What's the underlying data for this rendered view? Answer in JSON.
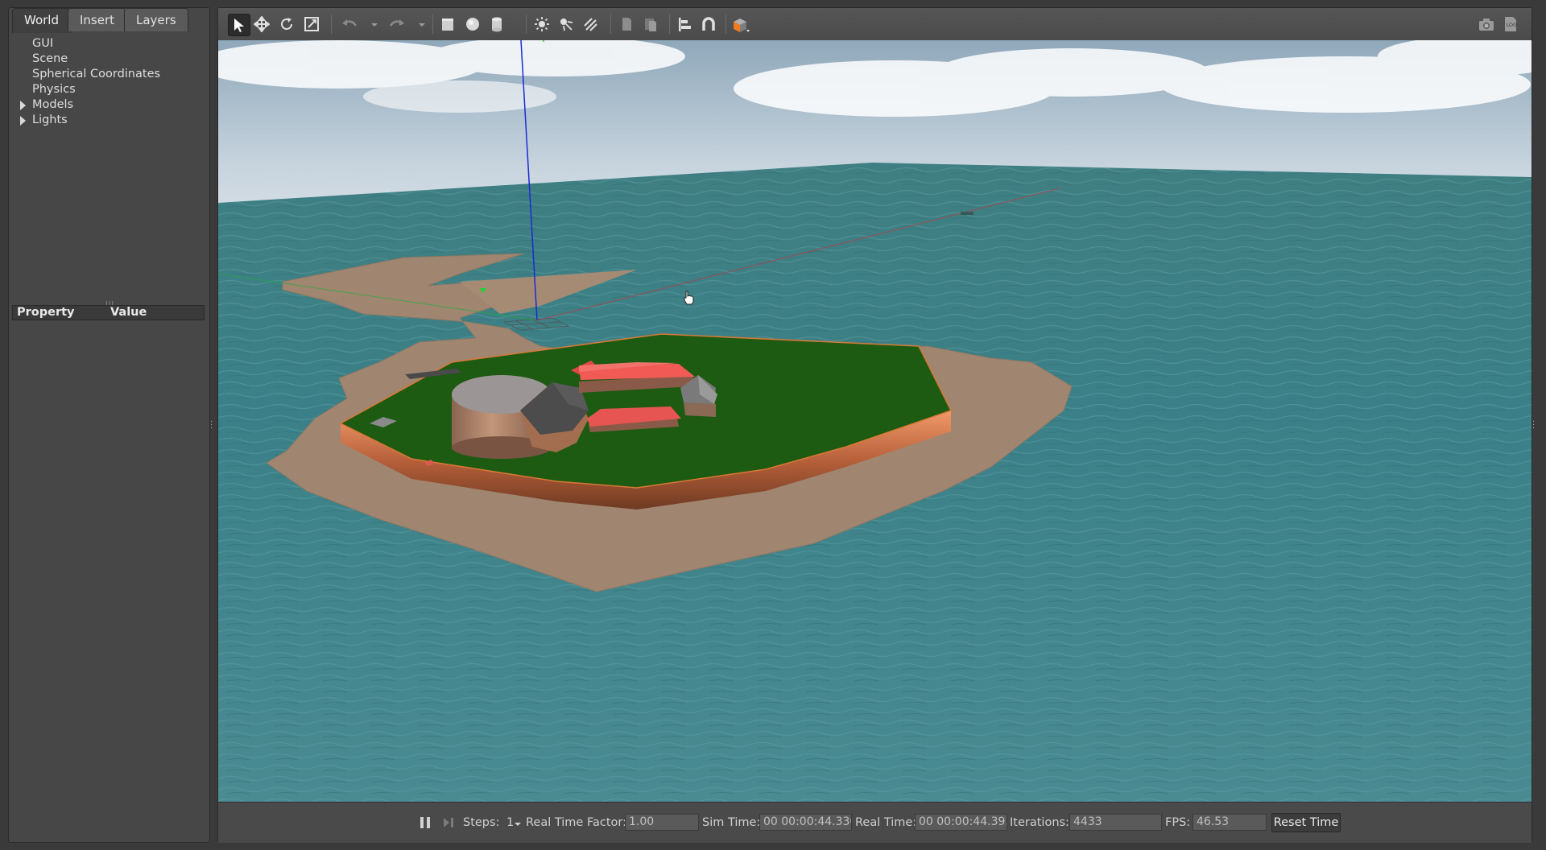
{
  "left_panel": {
    "tabs": [
      {
        "label": "World",
        "active": true
      },
      {
        "label": "Insert",
        "active": false
      },
      {
        "label": "Layers",
        "active": false
      }
    ],
    "tree": [
      {
        "label": "GUI",
        "expandable": false
      },
      {
        "label": "Scene",
        "expandable": false
      },
      {
        "label": "Spherical Coordinates",
        "expandable": false
      },
      {
        "label": "Physics",
        "expandable": false
      },
      {
        "label": "Models",
        "expandable": true
      },
      {
        "label": "Lights",
        "expandable": true
      }
    ],
    "property_header": {
      "property": "Property",
      "value": "Value"
    }
  },
  "toolbar": {
    "tools": [
      "select-arrow-icon",
      "translate-icon",
      "rotate-icon",
      "scale-icon",
      "undo-icon",
      "redo-icon",
      "box-icon",
      "sphere-icon",
      "cylinder-icon",
      "point-light-icon",
      "spot-light-icon",
      "directional-light-icon",
      "copy-icon",
      "paste-icon",
      "align-icon",
      "snap-magnet-icon",
      "change-view-icon",
      "camera-icon",
      "log-icon"
    ],
    "accent_color": "#f07a1e"
  },
  "bottom_bar": {
    "steps_label": "Steps:",
    "steps_value": "1",
    "rtf_label": "Real Time Factor:",
    "rtf_value": "1.00",
    "sim_time_label": "Sim Time:",
    "sim_time_value": "00 00:00:44.330",
    "real_time_label": "Real Time:",
    "real_time_value": "00 00:00:44.393",
    "iterations_label": "Iterations:",
    "iterations_value": "4433",
    "fps_label": "FPS:",
    "fps_value": "46.53",
    "reset_label": "Reset Time"
  },
  "scene_colors": {
    "sky": "#c9d6e0",
    "water": "#3e8287",
    "sand": "#a38872",
    "grass": "#1d5a12",
    "roof_red": "#f25a55",
    "roof_gray": "#6a6a6a"
  }
}
